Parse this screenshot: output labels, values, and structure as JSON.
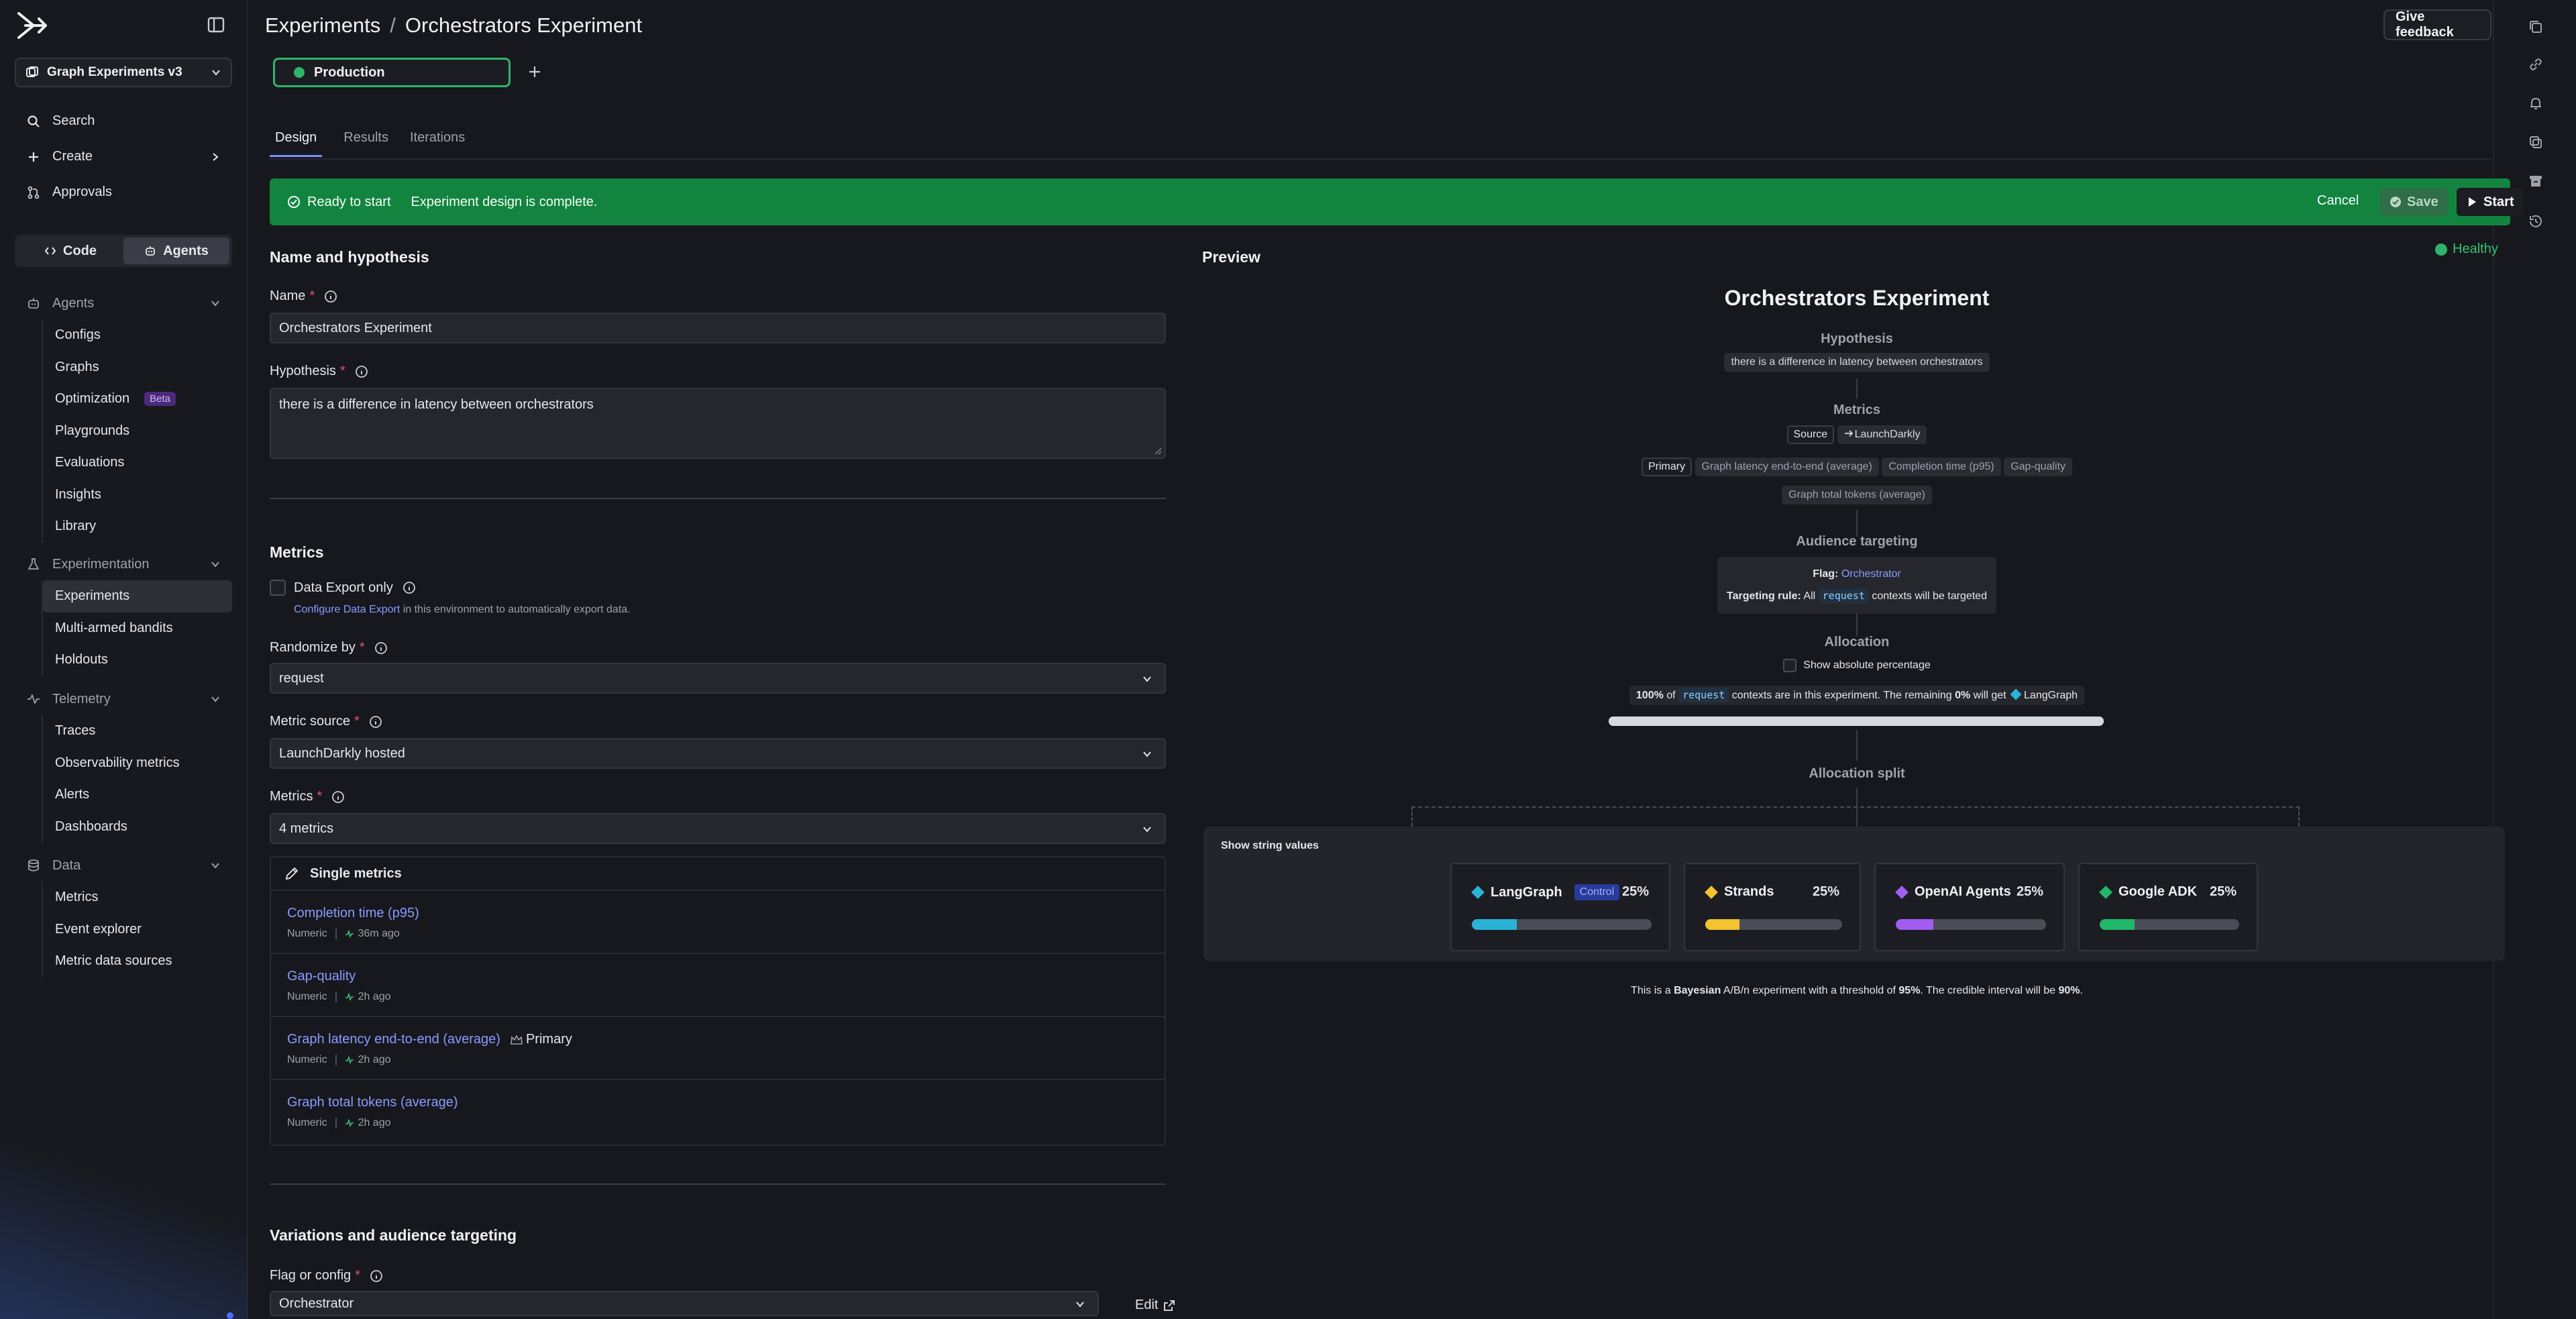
{
  "sidebar": {
    "project": "Graph Experiments v3",
    "top_items": [
      {
        "label": "Search"
      },
      {
        "label": "Create"
      },
      {
        "label": "Approvals"
      }
    ],
    "segment": {
      "code": "Code",
      "agents": "Agents"
    },
    "groups": [
      {
        "label": "Agents",
        "items": [
          "Configs",
          "Graphs",
          "Optimization",
          "Playgrounds",
          "Evaluations",
          "Insights",
          "Library"
        ],
        "badge": "Beta"
      },
      {
        "label": "Experimentation",
        "items": [
          "Experiments",
          "Multi-armed bandits",
          "Holdouts"
        ]
      },
      {
        "label": "Telemetry",
        "items": [
          "Traces",
          "Observability metrics",
          "Alerts",
          "Dashboards"
        ]
      },
      {
        "label": "Data",
        "items": [
          "Metrics",
          "Event explorer",
          "Metric data sources"
        ]
      }
    ]
  },
  "header": {
    "crumb_parent": "Experiments",
    "crumb_sep": "/",
    "crumb_current": "Orchestrators Experiment",
    "feedback": "Give feedback",
    "environment": "Production",
    "tabs": [
      "Design",
      "Results",
      "Iterations"
    ]
  },
  "banner": {
    "status": "Ready to start",
    "message": "Experiment design is complete.",
    "cancel": "Cancel",
    "save": "Save",
    "start": "Start"
  },
  "form": {
    "section1": "Name and hypothesis",
    "name_label": "Name",
    "name_value": "Orchestrators Experiment",
    "hypothesis_label": "Hypothesis",
    "hypothesis_value": "there is a difference in latency between orchestrators",
    "metrics_section": "Metrics",
    "data_export": "Data Export only",
    "configure_link": "Configure Data Export",
    "configure_rest": " in this environment to automatically export data.",
    "randomize_label": "Randomize by",
    "randomize_value": "request",
    "source_label": "Metric source",
    "source_value": "LaunchDarkly hosted",
    "metrics_label": "Metrics",
    "metrics_value": "4 metrics",
    "single_metrics": "Single metrics",
    "metrics": [
      {
        "name": "Completion time (p95)",
        "type": "Numeric",
        "time": "36m ago",
        "primary": ""
      },
      {
        "name": "Gap-quality",
        "type": "Numeric",
        "time": "2h ago",
        "primary": ""
      },
      {
        "name": "Graph latency end-to-end (average)",
        "type": "Numeric",
        "time": "2h ago",
        "primary": "Primary"
      },
      {
        "name": "Graph total tokens (average)",
        "type": "Numeric",
        "time": "2h ago",
        "primary": ""
      }
    ],
    "variations_section": "Variations and audience targeting",
    "flag_label": "Flag or config",
    "flag_value": "Orchestrator",
    "edit": "Edit"
  },
  "preview": {
    "label": "Preview",
    "healthy": "Healthy",
    "title": "Orchestrators Experiment",
    "hypothesis_head": "Hypothesis",
    "hypothesis": "there is a difference in latency between orchestrators",
    "metrics_head": "Metrics",
    "source_tag": "Source",
    "source_value": "LaunchDarkly",
    "primary_tag": "Primary",
    "metric_pills": [
      "Graph latency end-to-end (average)",
      "Completion time (p95)",
      "Gap-quality",
      "Graph total tokens (average)"
    ],
    "audience_head": "Audience targeting",
    "flag_label": "Flag:",
    "flag_value": "Orchestrator",
    "rule_label": "Targeting rule:",
    "rule_all": "All",
    "rule_code": "request",
    "rule_rest": "contexts will be targeted",
    "allocation_head": "Allocation",
    "show_abs": "Show absolute percentage",
    "alloc_pct": "100%",
    "alloc_of": "of",
    "alloc_code": "request",
    "alloc_mid": "contexts are in this experiment. The remaining",
    "alloc_rem": "0%",
    "alloc_get": "will get",
    "alloc_variation": "LangGraph",
    "alloc_fraction": 1.0,
    "split_head": "Allocation split",
    "show_strings": "Show string values",
    "variations": [
      {
        "name": "LangGraph",
        "pct": "25%",
        "fraction": 0.25,
        "color": "#2bb3d6",
        "control": "Control"
      },
      {
        "name": "Strands",
        "pct": "25%",
        "fraction": 0.25,
        "color": "#f2c230",
        "control": ""
      },
      {
        "name": "OpenAI Agents",
        "pct": "25%",
        "fraction": 0.25,
        "color": "#a25cf0",
        "control": ""
      },
      {
        "name": "Google ADK",
        "pct": "25%",
        "fraction": 0.25,
        "color": "#22b869",
        "control": ""
      }
    ],
    "bayes_pre": "This is a",
    "bayes_word": "Bayesian",
    "bayes_mid": "A/B/n experiment with a threshold of",
    "bayes_threshold": "95%",
    "bayes_mid2": ". The credible interval will be",
    "bayes_interval": "90%",
    "bayes_end": "."
  }
}
